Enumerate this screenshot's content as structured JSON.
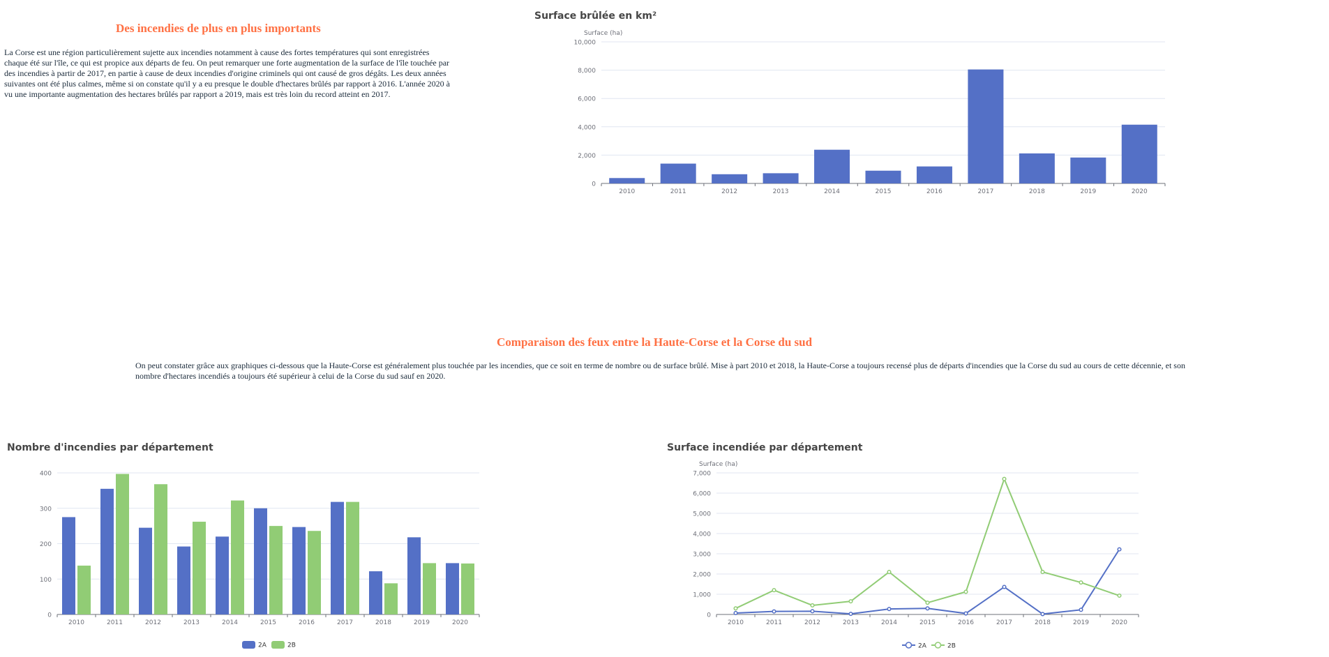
{
  "section1": {
    "title": "Des incendies de plus en plus importants",
    "text": "La Corse est une région particulièrement sujette aux incendies notamment à cause des fortes températures qui sont enregistrées chaque été sur l'île, ce qui est propice aux départs de feu. On peut remarquer une forte augmentation de la surface de l'île touchée par des incendies à partir de 2017, en partie à cause de deux incendies d'origine criminels qui ont causé de gros dégâts. Les deux années suivantes ont été plus calmes, même si on constate qu'il y a eu presque le double d'hectares brûlés par rapport à 2016. L'année 2020 à vu une importante augmentation des hectares brûlés par rapport a 2019, mais est très loin du record atteint en 2017."
  },
  "section2": {
    "title": "Comparaison des feux entre la Haute-Corse et la Corse du sud",
    "text": "On peut constater grâce aux graphiques ci-dessous que la Haute-Corse est généralement plus touchée par les incendies, que ce soit en terme de nombre ou de surface brûlé. Mise à part 2010 et 2018, la Haute-Corse a toujours recensé plus de départs d'incendies que la Corse du sud au cours de cette décennie, et son nombre d'hectares incendiés a toujours été supérieur à celui de la Corse du sud sauf en 2020."
  },
  "colors": {
    "blue": "#5470c6",
    "green": "#91cc75",
    "axis": "#6e7079",
    "grid": "#e0e6f1",
    "title_orange": "#ff7043"
  },
  "chart_data": [
    {
      "id": "surface-brulee",
      "type": "bar",
      "title": "Surface brûlée en km²",
      "ylabel": "Surface (ha)",
      "categories": [
        "2010",
        "2011",
        "2012",
        "2013",
        "2014",
        "2015",
        "2016",
        "2017",
        "2018",
        "2019",
        "2020"
      ],
      "series": [
        {
          "values": [
            380,
            1400,
            650,
            720,
            2380,
            900,
            1200,
            8050,
            2120,
            1830,
            4150
          ]
        }
      ],
      "ylim": [
        0,
        10000
      ],
      "yticks": [
        0,
        2000,
        4000,
        6000,
        8000,
        10000
      ],
      "grid": true
    },
    {
      "id": "nombre-incendies",
      "type": "bar",
      "title": "Nombre d'incendies par département",
      "ylabel": "",
      "categories": [
        "2010",
        "2011",
        "2012",
        "2013",
        "2014",
        "2015",
        "2016",
        "2017",
        "2018",
        "2019",
        "2020"
      ],
      "series": [
        {
          "name": "2A",
          "values": [
            275,
            355,
            245,
            192,
            220,
            300,
            247,
            318,
            122,
            218,
            145
          ]
        },
        {
          "name": "2B",
          "values": [
            138,
            397,
            368,
            262,
            322,
            250,
            236,
            318,
            88,
            145,
            144
          ]
        }
      ],
      "ylim": [
        0,
        400
      ],
      "yticks": [
        0,
        100,
        200,
        300,
        400
      ],
      "legend": "bottom-center",
      "grid": true
    },
    {
      "id": "surface-departement",
      "type": "line",
      "title": "Surface incendiée par département",
      "ylabel": "Surface (ha)",
      "categories": [
        "2010",
        "2011",
        "2012",
        "2013",
        "2014",
        "2015",
        "2016",
        "2017",
        "2018",
        "2019",
        "2020"
      ],
      "series": [
        {
          "name": "2A",
          "values": [
            70,
            150,
            160,
            30,
            270,
            300,
            50,
            1360,
            20,
            230,
            3220
          ]
        },
        {
          "name": "2B",
          "values": [
            300,
            1200,
            450,
            650,
            2100,
            580,
            1120,
            6700,
            2100,
            1580,
            930
          ]
        }
      ],
      "ylim": [
        0,
        7000
      ],
      "yticks": [
        0,
        1000,
        2000,
        3000,
        4000,
        5000,
        6000,
        7000
      ],
      "legend": "bottom-center",
      "grid": true
    }
  ]
}
